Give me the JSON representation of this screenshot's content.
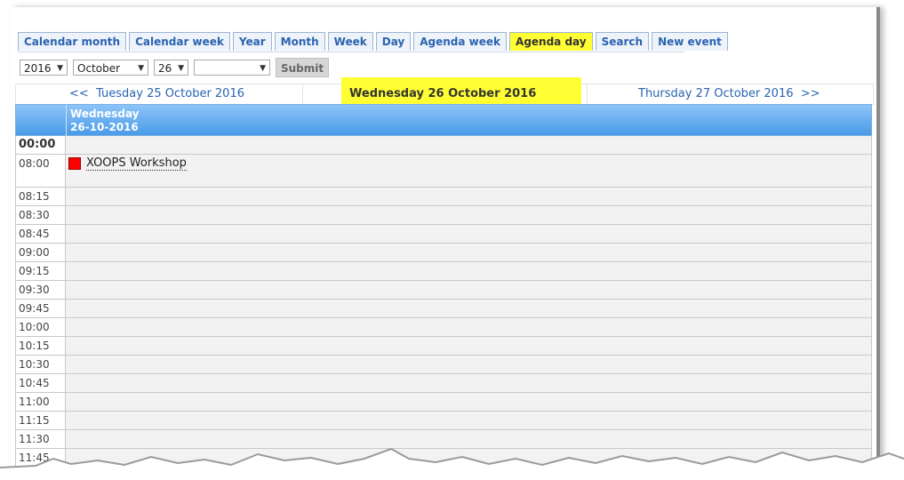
{
  "tabs": [
    {
      "label": "Calendar month",
      "active": false
    },
    {
      "label": "Calendar week",
      "active": false
    },
    {
      "label": "Year",
      "active": false
    },
    {
      "label": "Month",
      "active": false
    },
    {
      "label": "Week",
      "active": false
    },
    {
      "label": "Day",
      "active": false
    },
    {
      "label": "Agenda week",
      "active": false
    },
    {
      "label": "Agenda day",
      "active": true
    },
    {
      "label": "Search",
      "active": false
    },
    {
      "label": "New event",
      "active": false
    }
  ],
  "form": {
    "year": "2016",
    "month": "October",
    "day": "26",
    "category": "",
    "submit_label": "Submit"
  },
  "nav": {
    "prev_arrow": "<<",
    "prev_label": "Tuesday 25 October 2016",
    "current_label": "Wednesday 26 October 2016",
    "next_label": "Thursday 27 October 2016",
    "next_arrow": ">>"
  },
  "header": {
    "weekday": "Wednesday",
    "date": "26-10-2016"
  },
  "rows": [
    {
      "time": "00:00",
      "bold": true,
      "events": []
    },
    {
      "time": "08:00",
      "bold": false,
      "events": [
        {
          "title": "XOOPS Workshop",
          "color": "#ff0000"
        }
      ]
    },
    {
      "time": "08:15",
      "bold": false,
      "events": []
    },
    {
      "time": "08:30",
      "bold": false,
      "events": []
    },
    {
      "time": "08:45",
      "bold": false,
      "events": []
    },
    {
      "time": "09:00",
      "bold": false,
      "events": []
    },
    {
      "time": "09:15",
      "bold": false,
      "events": []
    },
    {
      "time": "09:30",
      "bold": false,
      "events": []
    },
    {
      "time": "09:45",
      "bold": false,
      "events": []
    },
    {
      "time": "10:00",
      "bold": false,
      "events": []
    },
    {
      "time": "10:15",
      "bold": false,
      "events": []
    },
    {
      "time": "10:30",
      "bold": false,
      "events": []
    },
    {
      "time": "10:45",
      "bold": false,
      "events": []
    },
    {
      "time": "11:00",
      "bold": false,
      "events": []
    },
    {
      "time": "11:15",
      "bold": false,
      "events": []
    },
    {
      "time": "11:30",
      "bold": false,
      "events": []
    },
    {
      "time": "11:45",
      "bold": false,
      "events": []
    }
  ],
  "colors": {
    "tab_text": "#2a63b0",
    "active_tab": "#ffff33",
    "header_gradient_top": "#8cc4f8",
    "header_gradient_bottom": "#4a9be8",
    "row_bg": "#f2f2f2",
    "event_swatch": "#ff0000"
  }
}
